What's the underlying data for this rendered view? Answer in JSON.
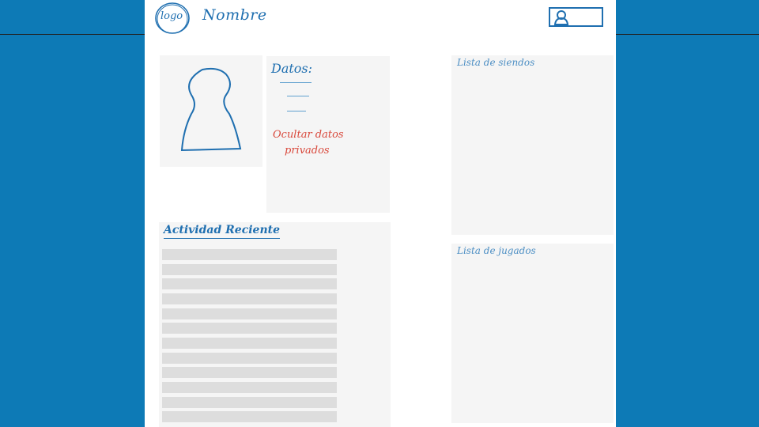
{
  "header": {
    "logo_text": "logo",
    "site_name": "Nombre",
    "user_icon": "user-icon"
  },
  "profile": {
    "avatar_icon": "avatar-placeholder-icon",
    "datos_title": "Datos:",
    "hide_private_line1": "Ocultar datos",
    "hide_private_line2": "privados"
  },
  "activity": {
    "title": "Actividad Reciente",
    "row_count_visible": 12
  },
  "lists": {
    "following_title": "Lista de siendos",
    "played_title": "Lista de jugados"
  },
  "colors": {
    "background": "#0d7ab6",
    "accent_blue": "#1f6fb0",
    "link_red": "#d9493c",
    "panel": "#f5f5f5",
    "placeholder_row": "#dddddd"
  }
}
